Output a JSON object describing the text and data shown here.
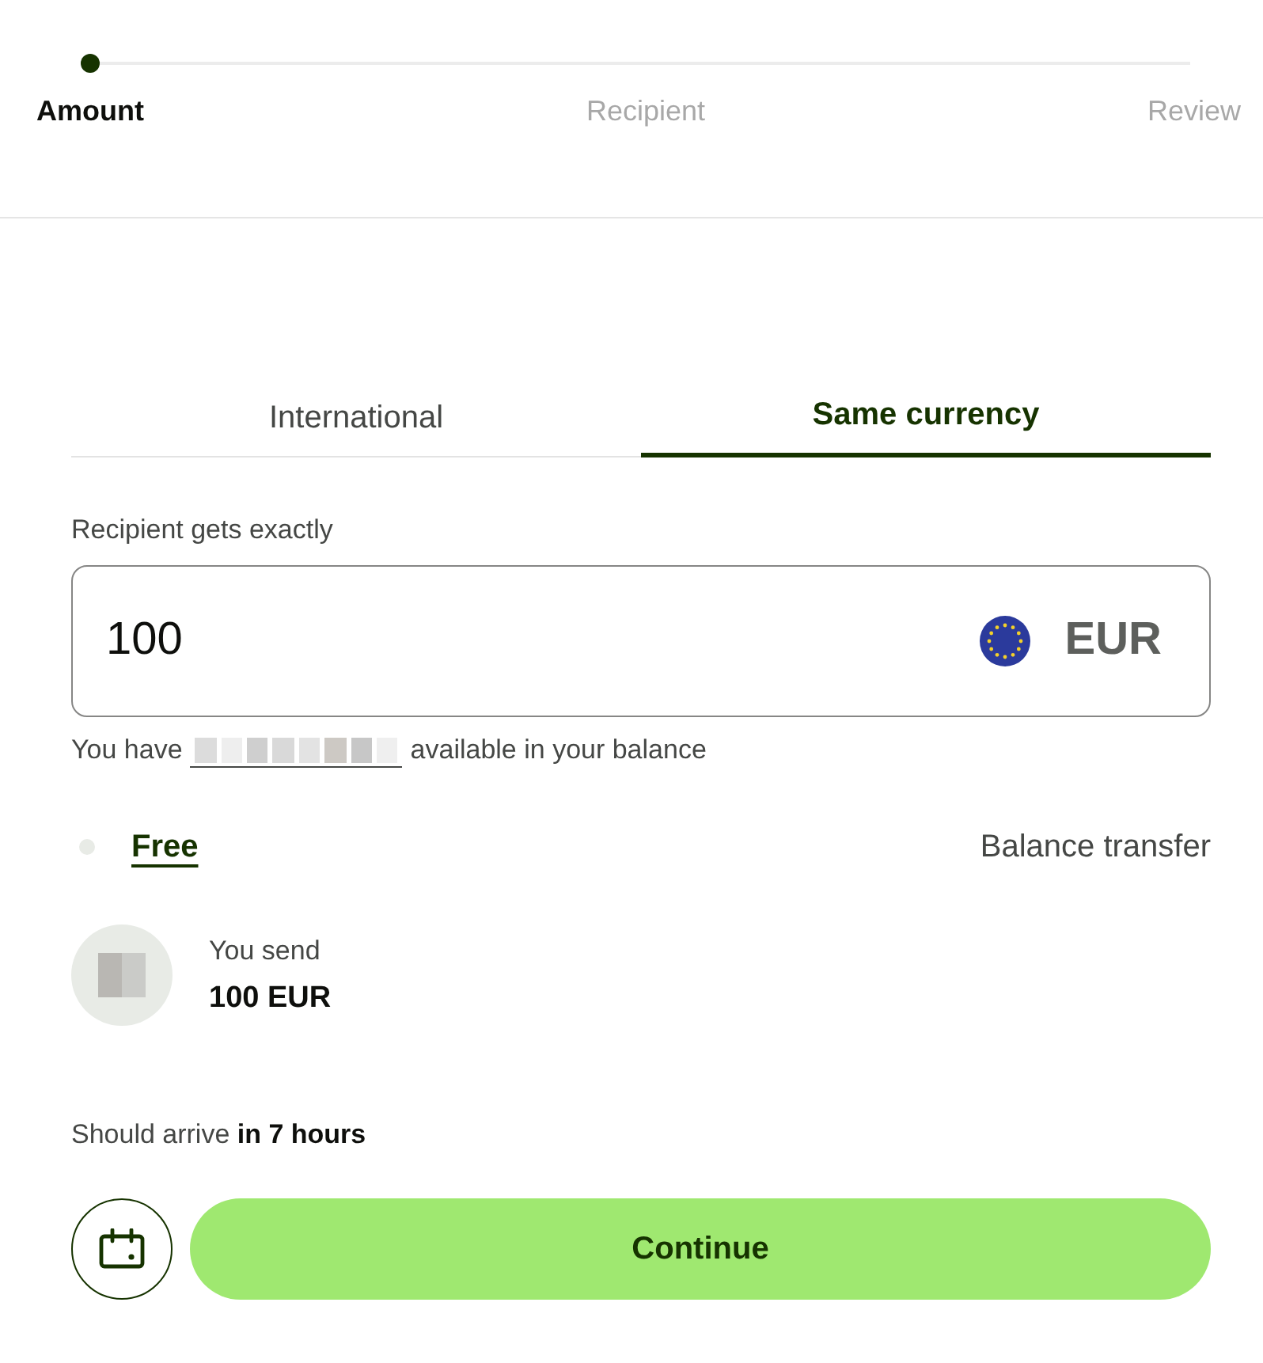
{
  "stepper": {
    "steps": [
      {
        "label": "Amount",
        "selected": true
      },
      {
        "label": "Recipient",
        "selected": false
      },
      {
        "label": "Review",
        "selected": false
      }
    ]
  },
  "tabs": [
    {
      "label": "International",
      "selected": false
    },
    {
      "label": "Same currency",
      "selected": true
    }
  ],
  "amount_field": {
    "label": "Recipient gets exactly",
    "value": "100",
    "currency": "EUR"
  },
  "balance_note": {
    "before": "You have",
    "after": "available in your balance"
  },
  "fee": {
    "amount": "Free",
    "method": "Balance transfer"
  },
  "summary": {
    "label": "You send",
    "amount": "100 EUR"
  },
  "arrival": "Should arrive **in 7 hours**",
  "continue_button": "Continue"
}
